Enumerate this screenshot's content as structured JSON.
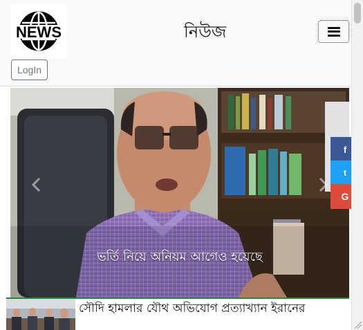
{
  "header": {
    "logo_text": "NEWS",
    "site_title": "নিউজ",
    "login_label": "LogIn"
  },
  "carousel": {
    "caption": "ভর্তি নিয়ে অনিয়ম আগেও হয়েছে"
  },
  "share": {
    "facebook": "f",
    "twitter": "t",
    "google": "G"
  },
  "news": {
    "headline": "সৌদি হামলার যৌথ অভিযোগ প্রত্যাখ্যান ইরানের"
  },
  "colors": {
    "facebook": "#3b5998",
    "twitter": "#1da1f2",
    "google": "#dd4b39",
    "accent_line": "#1e8a3a"
  }
}
